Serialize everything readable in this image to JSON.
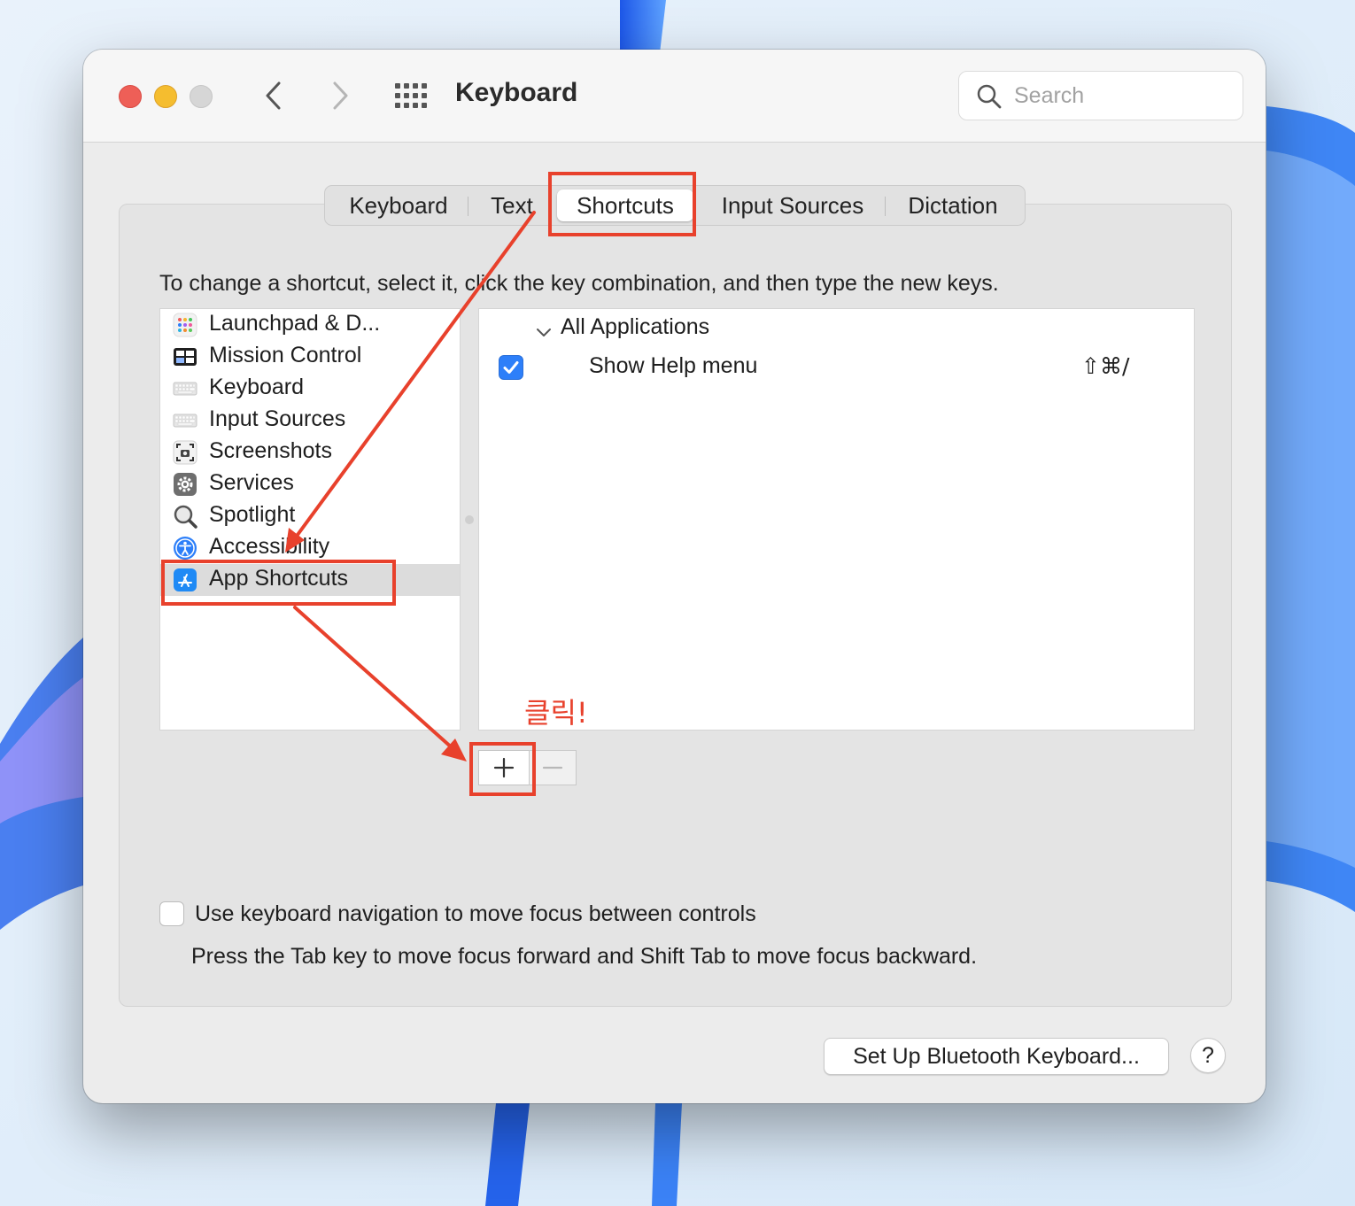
{
  "window": {
    "title": "Keyboard",
    "search_placeholder": "Search"
  },
  "tabs": [
    {
      "label": "Keyboard",
      "active": false
    },
    {
      "label": "Text",
      "active": false
    },
    {
      "label": "Shortcuts",
      "active": true
    },
    {
      "label": "Input Sources",
      "active": false
    },
    {
      "label": "Dictation",
      "active": false
    }
  ],
  "shortcuts": {
    "instruction": "To change a shortcut, select it, click the key combination, and then type the new keys.",
    "categories": [
      {
        "label": "Launchpad & D...",
        "icon": "launchpad-icon",
        "selected": false
      },
      {
        "label": "Mission Control",
        "icon": "mission-control-icon",
        "selected": false
      },
      {
        "label": "Keyboard",
        "icon": "keyboard-icon",
        "selected": false
      },
      {
        "label": "Input Sources",
        "icon": "input-sources-icon",
        "selected": false
      },
      {
        "label": "Screenshots",
        "icon": "screenshots-icon",
        "selected": false
      },
      {
        "label": "Services",
        "icon": "services-gear-icon",
        "selected": false
      },
      {
        "label": "Spotlight",
        "icon": "spotlight-magnifier-icon",
        "selected": false
      },
      {
        "label": "Accessibility",
        "icon": "accessibility-icon",
        "selected": false
      },
      {
        "label": "App Shortcuts",
        "icon": "app-store-icon",
        "selected": true
      }
    ],
    "group_label": "All Applications",
    "items": [
      {
        "label": "Show Help menu",
        "keys": "⇧⌘/",
        "checked": true
      }
    ],
    "add_label": "+",
    "remove_label": "−"
  },
  "keyboard_navigation": {
    "label": "Use keyboard navigation to move focus between controls",
    "hint": "Press the Tab key to move focus forward and Shift Tab to move focus backward.",
    "checked": false
  },
  "footer": {
    "bluetooth_button": "Set Up Bluetooth Keyboard...",
    "help_button": "?"
  },
  "annotation": {
    "click_text": "클릭!",
    "color": "#e8412c"
  },
  "colors": {
    "accent": "#2d7ff9",
    "window_bg": "#ececec",
    "traffic_red": "#ee5f57",
    "traffic_yellow": "#f5bd2f"
  }
}
